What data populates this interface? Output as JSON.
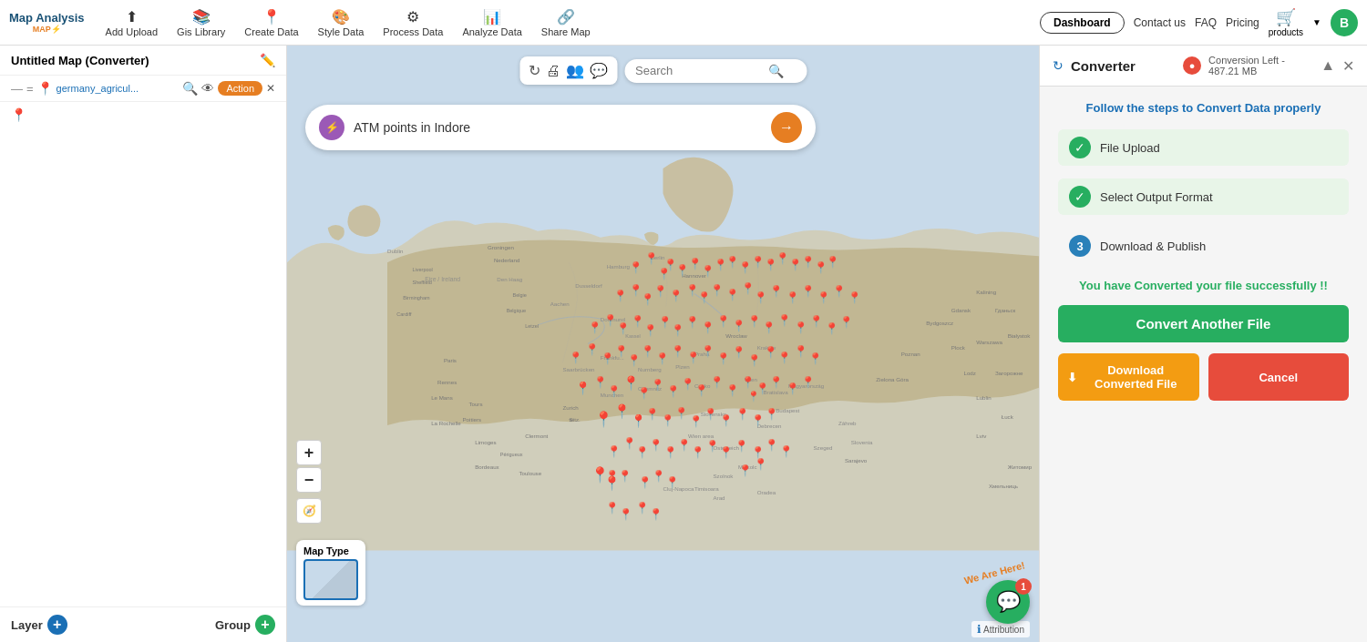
{
  "navbar": {
    "logo_title": "Map Analysis",
    "logo_sub": "MAP⚡",
    "items": [
      {
        "id": "add-upload",
        "label": "Add Upload",
        "icon": "⬆"
      },
      {
        "id": "gis-library",
        "label": "Gis Library",
        "icon": "📚"
      },
      {
        "id": "create-data",
        "label": "Create Data",
        "icon": "📍"
      },
      {
        "id": "style-data",
        "label": "Style Data",
        "icon": "🎨"
      },
      {
        "id": "process-data",
        "label": "Process Data",
        "icon": "⚙"
      },
      {
        "id": "analyze-data",
        "label": "Analyze Data",
        "icon": "📊"
      },
      {
        "id": "share-map",
        "label": "Share Map",
        "icon": "🔗"
      }
    ],
    "dashboard_label": "Dashboard",
    "contact_label": "Contact us",
    "faq_label": "FAQ",
    "pricing_label": "Pricing",
    "products_label": "products",
    "user_initial": "B"
  },
  "sidebar": {
    "title": "Untitled Map (Converter)",
    "layer_name": "germany_agricul...",
    "action_label": "Action",
    "layer_button": "Layer",
    "group_button": "Group"
  },
  "map": {
    "search_placeholder": "Search",
    "layer_search_text": "ATM points in Indore",
    "map_type_label": "Map Type",
    "zoom_in": "+",
    "zoom_out": "−",
    "attribution": "Attribution"
  },
  "converter": {
    "title": "Converter",
    "conversion_left": "Conversion Left - 487.21 MB",
    "subtitle": "Follow the steps to Convert Data properly",
    "steps": [
      {
        "id": 1,
        "label": "File Upload",
        "status": "completed"
      },
      {
        "id": 2,
        "label": "Select Output Format",
        "status": "completed"
      },
      {
        "id": 3,
        "label": "Download & Publish",
        "status": "active"
      }
    ],
    "success_message": "You have Converted your file successfully !!",
    "convert_another_btn": "Convert Another File",
    "download_btn": "Download Converted File",
    "cancel_btn": "Cancel"
  },
  "chat": {
    "badge_count": "1"
  },
  "we_are_here": "We Are Here!"
}
